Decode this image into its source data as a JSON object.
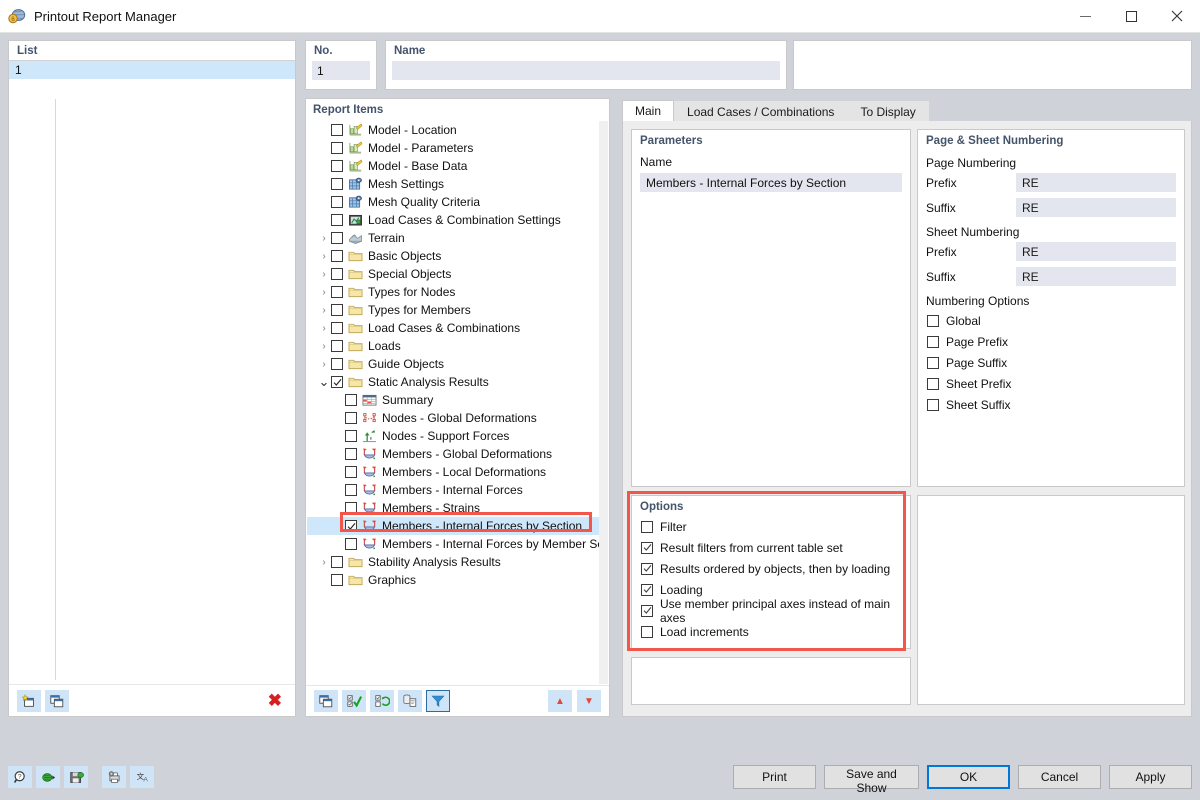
{
  "window": {
    "title": "Printout Report Manager",
    "icon": "report-manager-icon",
    "minimize": "minimize-icon",
    "maximize": "maximize-icon",
    "close": "close-icon"
  },
  "list_panel": {
    "header": "List",
    "rows": [
      {
        "no": "1",
        "name": ""
      }
    ],
    "toolbar": [
      {
        "name": "new-report-button",
        "icon": "new-window-icon"
      },
      {
        "name": "copy-report-button",
        "icon": "copy-window-icon"
      }
    ],
    "delete_button": {
      "name": "delete-button",
      "icon": "red-x-icon",
      "glyph": "✖"
    }
  },
  "fields": {
    "no_label": "No.",
    "no_value": "1",
    "name_label": "Name",
    "name_value": "",
    "name_placeholder": ""
  },
  "tree": {
    "title": "Report Items",
    "items": [
      {
        "label": "Model - Location",
        "depth": 1,
        "chevron": "",
        "checked": false,
        "icon": "model-chart-icon"
      },
      {
        "label": "Model - Parameters",
        "depth": 1,
        "chevron": "",
        "checked": false,
        "icon": "model-chart-icon"
      },
      {
        "label": "Model - Base Data",
        "depth": 1,
        "chevron": "",
        "checked": false,
        "icon": "model-chart-icon"
      },
      {
        "label": "Mesh Settings",
        "depth": 1,
        "chevron": "",
        "checked": false,
        "icon": "mesh-icon"
      },
      {
        "label": "Mesh Quality Criteria",
        "depth": 1,
        "chevron": "",
        "checked": false,
        "icon": "mesh-icon"
      },
      {
        "label": "Load Cases & Combination Settings",
        "depth": 1,
        "chevron": "",
        "checked": false,
        "icon": "load-settings-icon"
      },
      {
        "label": "Terrain",
        "depth": 1,
        "chevron": "›",
        "checked": false,
        "icon": "terrain-icon"
      },
      {
        "label": "Basic Objects",
        "depth": 1,
        "chevron": "›",
        "checked": false,
        "icon": "folder-icon"
      },
      {
        "label": "Special Objects",
        "depth": 1,
        "chevron": "›",
        "checked": false,
        "icon": "folder-icon"
      },
      {
        "label": "Types for Nodes",
        "depth": 1,
        "chevron": "›",
        "checked": false,
        "icon": "folder-icon"
      },
      {
        "label": "Types for Members",
        "depth": 1,
        "chevron": "›",
        "checked": false,
        "icon": "folder-icon"
      },
      {
        "label": "Load Cases & Combinations",
        "depth": 1,
        "chevron": "›",
        "checked": false,
        "icon": "folder-icon"
      },
      {
        "label": "Loads",
        "depth": 1,
        "chevron": "›",
        "checked": false,
        "icon": "folder-icon"
      },
      {
        "label": "Guide Objects",
        "depth": 1,
        "chevron": "›",
        "checked": false,
        "icon": "folder-icon"
      },
      {
        "label": "Static Analysis Results",
        "depth": 1,
        "chevron": "⌄",
        "checked": true,
        "icon": "folder-icon"
      },
      {
        "label": "Summary",
        "depth": 2,
        "chevron": "",
        "checked": false,
        "icon": "summary-table-icon"
      },
      {
        "label": "Nodes - Global Deformations",
        "depth": 2,
        "chevron": "",
        "checked": false,
        "icon": "nodes-deformation-icon"
      },
      {
        "label": "Nodes - Support Forces",
        "depth": 2,
        "chevron": "",
        "checked": false,
        "icon": "support-forces-icon"
      },
      {
        "label": "Members - Global Deformations",
        "depth": 2,
        "chevron": "",
        "checked": false,
        "icon": "member-diagram-icon"
      },
      {
        "label": "Members - Local Deformations",
        "depth": 2,
        "chevron": "",
        "checked": false,
        "icon": "member-diagram-icon"
      },
      {
        "label": "Members - Internal Forces",
        "depth": 2,
        "chevron": "",
        "checked": false,
        "icon": "member-diagram-icon"
      },
      {
        "label": "Members - Strains",
        "depth": 2,
        "chevron": "",
        "checked": false,
        "icon": "member-diagram-icon"
      },
      {
        "label": "Members - Internal Forces by Section",
        "depth": 2,
        "chevron": "",
        "checked": true,
        "icon": "member-diagram-icon",
        "selected": true,
        "highlighted": true
      },
      {
        "label": "Members - Internal Forces by Member Set",
        "depth": 2,
        "chevron": "",
        "checked": false,
        "icon": "member-diagram-icon"
      },
      {
        "label": "Stability Analysis Results",
        "depth": 1,
        "chevron": "›",
        "checked": false,
        "icon": "folder-icon"
      },
      {
        "label": "Graphics",
        "depth": 1,
        "chevron": "",
        "checked": false,
        "icon": "folder-icon"
      }
    ],
    "toolbar": [
      {
        "name": "new-item-button",
        "icon": "copy-window-icon"
      },
      {
        "name": "select-all-button",
        "icon": "check-all-icon"
      },
      {
        "name": "invert-selection-button",
        "icon": "invert-selection-icon"
      },
      {
        "name": "duplicate-item-button",
        "icon": "duplicate-icon"
      },
      {
        "name": "filter-button",
        "icon": "filter-funnel-icon",
        "active": true
      }
    ],
    "move_up": {
      "name": "move-up-button",
      "glyph": "▲"
    },
    "move_down": {
      "name": "move-down-button",
      "glyph": "▼"
    }
  },
  "tabs": [
    {
      "label": "Main",
      "active": true
    },
    {
      "label": "Load Cases / Combinations",
      "active": false
    },
    {
      "label": "To Display",
      "active": false
    }
  ],
  "parameters": {
    "title": "Parameters",
    "name_label": "Name",
    "name_value": "Members - Internal Forces by Section"
  },
  "numbering": {
    "title": "Page & Sheet Numbering",
    "page_heading": "Page Numbering",
    "page_prefix_label": "Prefix",
    "page_prefix_value": "RE",
    "page_suffix_label": "Suffix",
    "page_suffix_value": "RE",
    "sheet_heading": "Sheet Numbering",
    "sheet_prefix_label": "Prefix",
    "sheet_prefix_value": "RE",
    "sheet_suffix_label": "Suffix",
    "sheet_suffix_value": "RE",
    "options_heading": "Numbering Options",
    "options": [
      {
        "label": "Global",
        "checked": false
      },
      {
        "label": "Page Prefix",
        "checked": false
      },
      {
        "label": "Page Suffix",
        "checked": false
      },
      {
        "label": "Sheet Prefix",
        "checked": false
      },
      {
        "label": "Sheet Suffix",
        "checked": false
      }
    ]
  },
  "options": {
    "title": "Options",
    "highlighted": true,
    "items": [
      {
        "label": "Filter",
        "checked": false
      },
      {
        "label": "Result filters from current table set",
        "checked": true
      },
      {
        "label": "Results ordered by objects, then by loading",
        "checked": true
      },
      {
        "label": "Loading",
        "checked": true
      },
      {
        "label": "Use member principal axes instead of main axes",
        "checked": true
      },
      {
        "label": "Load increments",
        "checked": false
      }
    ]
  },
  "footer": {
    "tools": [
      {
        "name": "help-button",
        "icon": "help-magnifier-icon"
      },
      {
        "name": "export-button",
        "icon": "export-icon"
      },
      {
        "name": "save-config-button",
        "icon": "save-icon"
      },
      {
        "name": "printer-settings-button",
        "icon": "printer-settings-icon"
      },
      {
        "name": "language-button",
        "icon": "translate-icon"
      }
    ],
    "buttons": [
      {
        "label": "Print",
        "name": "print-button",
        "default": false
      },
      {
        "label": "Save and Show",
        "name": "save-and-show-button",
        "default": false
      },
      {
        "label": "OK",
        "name": "ok-button",
        "default": true
      },
      {
        "label": "Cancel",
        "name": "cancel-button",
        "default": false
      },
      {
        "label": "Apply",
        "name": "apply-button",
        "default": false
      }
    ]
  },
  "colors": {
    "accent": "#0078d7",
    "highlight_red": "#f3564a",
    "selection_blue": "#cfe7fa",
    "field_bg": "#e4e6ef",
    "section_title": "#44546a"
  }
}
